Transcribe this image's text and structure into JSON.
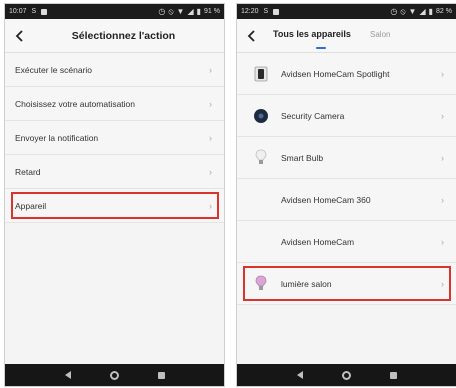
{
  "left_screen": {
    "status": {
      "time": "10:07",
      "carrier": "S",
      "battery": "91 %"
    },
    "header": {
      "title": "Sélectionnez l'action"
    },
    "menu": [
      {
        "label": "Exécuter le scénario"
      },
      {
        "label": "Choisissez votre automatisation"
      },
      {
        "label": "Envoyer la notification"
      },
      {
        "label": "Retard"
      },
      {
        "label": "Appareil",
        "highlighted": true
      }
    ]
  },
  "right_screen": {
    "status": {
      "time": "12:20",
      "carrier": "S",
      "battery": "82 %"
    },
    "tabs": [
      {
        "label": "Tous les appareils",
        "active": true
      },
      {
        "label": "Salon",
        "active": false
      }
    ],
    "devices": [
      {
        "label": "Avidsen HomeCam Spotlight",
        "icon": "spotlight-camera-icon"
      },
      {
        "label": "Security Camera",
        "icon": "dome-camera-icon"
      },
      {
        "label": "Smart Bulb",
        "icon": "bulb-icon"
      },
      {
        "label": "Avidsen HomeCam 360",
        "icon": ""
      },
      {
        "label": "Avidsen HomeCam",
        "icon": ""
      },
      {
        "label": "lumière salon",
        "icon": "color-bulb-icon",
        "highlighted": true
      }
    ]
  },
  "colors": {
    "highlight": "#d9332d",
    "tab_accent": "#2b6fd6"
  }
}
